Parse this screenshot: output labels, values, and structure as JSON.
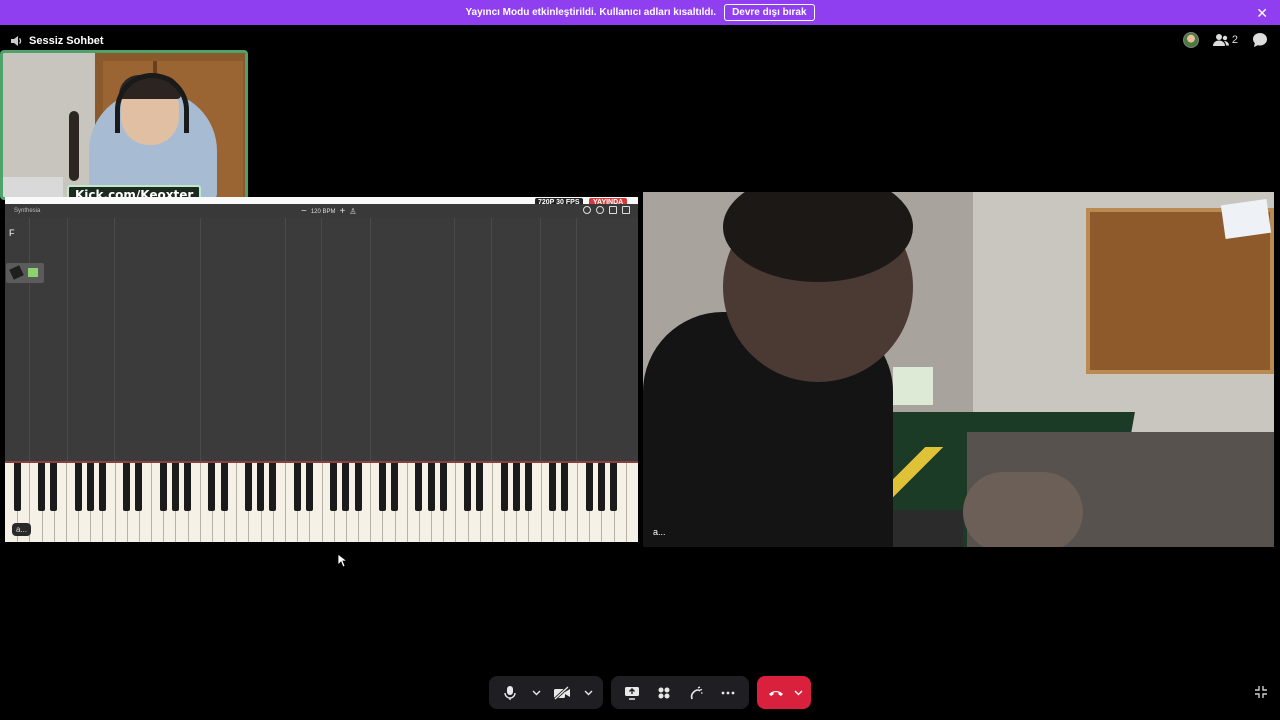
{
  "banner": {
    "text": "Yayıncı Modu etkinleştirildi. Kullanıcı adları kısaltıldı.",
    "button_label": "Devre dışı bırak",
    "close_icon": "close-icon",
    "background": "#8f3ff0"
  },
  "channel": {
    "icon": "speaker-icon",
    "name": "Sessiz Sohbet"
  },
  "topbar": {
    "participant_count": "2",
    "icons": [
      "avatar",
      "people-icon",
      "chat-bubble-icon"
    ]
  },
  "webcam_overlay": {
    "watermark": "Kick.com/Keoxter",
    "border_color": "#4fa36a"
  },
  "screen_share": {
    "app_name": "Synthesia",
    "tempo": "120 BPM",
    "quality_badge": "720P 30 FPS",
    "live_badge": "YAYINDA",
    "note_label": "F",
    "octave_labels": [
      "C4"
    ],
    "user_label": "a..."
  },
  "camera_tile": {
    "user_label": "a..."
  },
  "controls": {
    "buttons": [
      "microphone-icon",
      "chevron-down-icon",
      "camera-off-icon",
      "chevron-down-icon",
      "screen-share-icon",
      "activities-icon",
      "soundboard-icon",
      "more-icon",
      "end-call-icon",
      "chevron-down-icon"
    ],
    "end_call_color": "#d9213d"
  }
}
